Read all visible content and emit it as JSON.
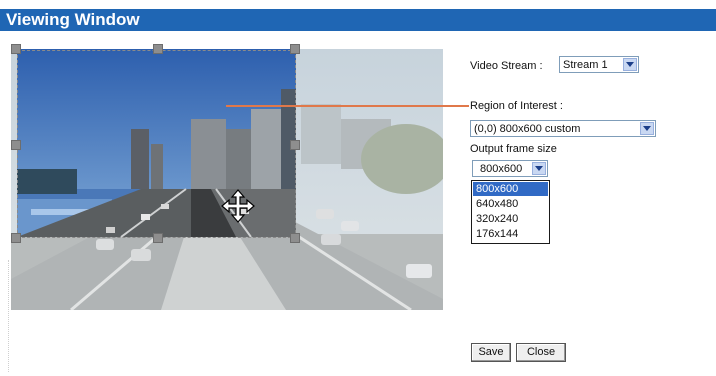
{
  "window": {
    "title": "Viewing Window"
  },
  "video_stream": {
    "label": "Video Stream :",
    "selected": "Stream 1"
  },
  "roi": {
    "label": "Region of Interest :",
    "selected": "(0,0) 800x600 custom"
  },
  "output_frame": {
    "label": "Output frame size",
    "selected": "800x600",
    "options": [
      "800x600",
      "640x480",
      "320x240",
      "176x144"
    ],
    "highlighted_index": 0
  },
  "buttons": {
    "save": "Save",
    "close": "Close"
  },
  "colors": {
    "header_bg": "#1f66b4",
    "leader_line": "#e0784a",
    "option_highlight": "#316ac5"
  },
  "icons": {
    "move": "move-cursor-icon",
    "dropdown": "chevron-down-icon"
  }
}
